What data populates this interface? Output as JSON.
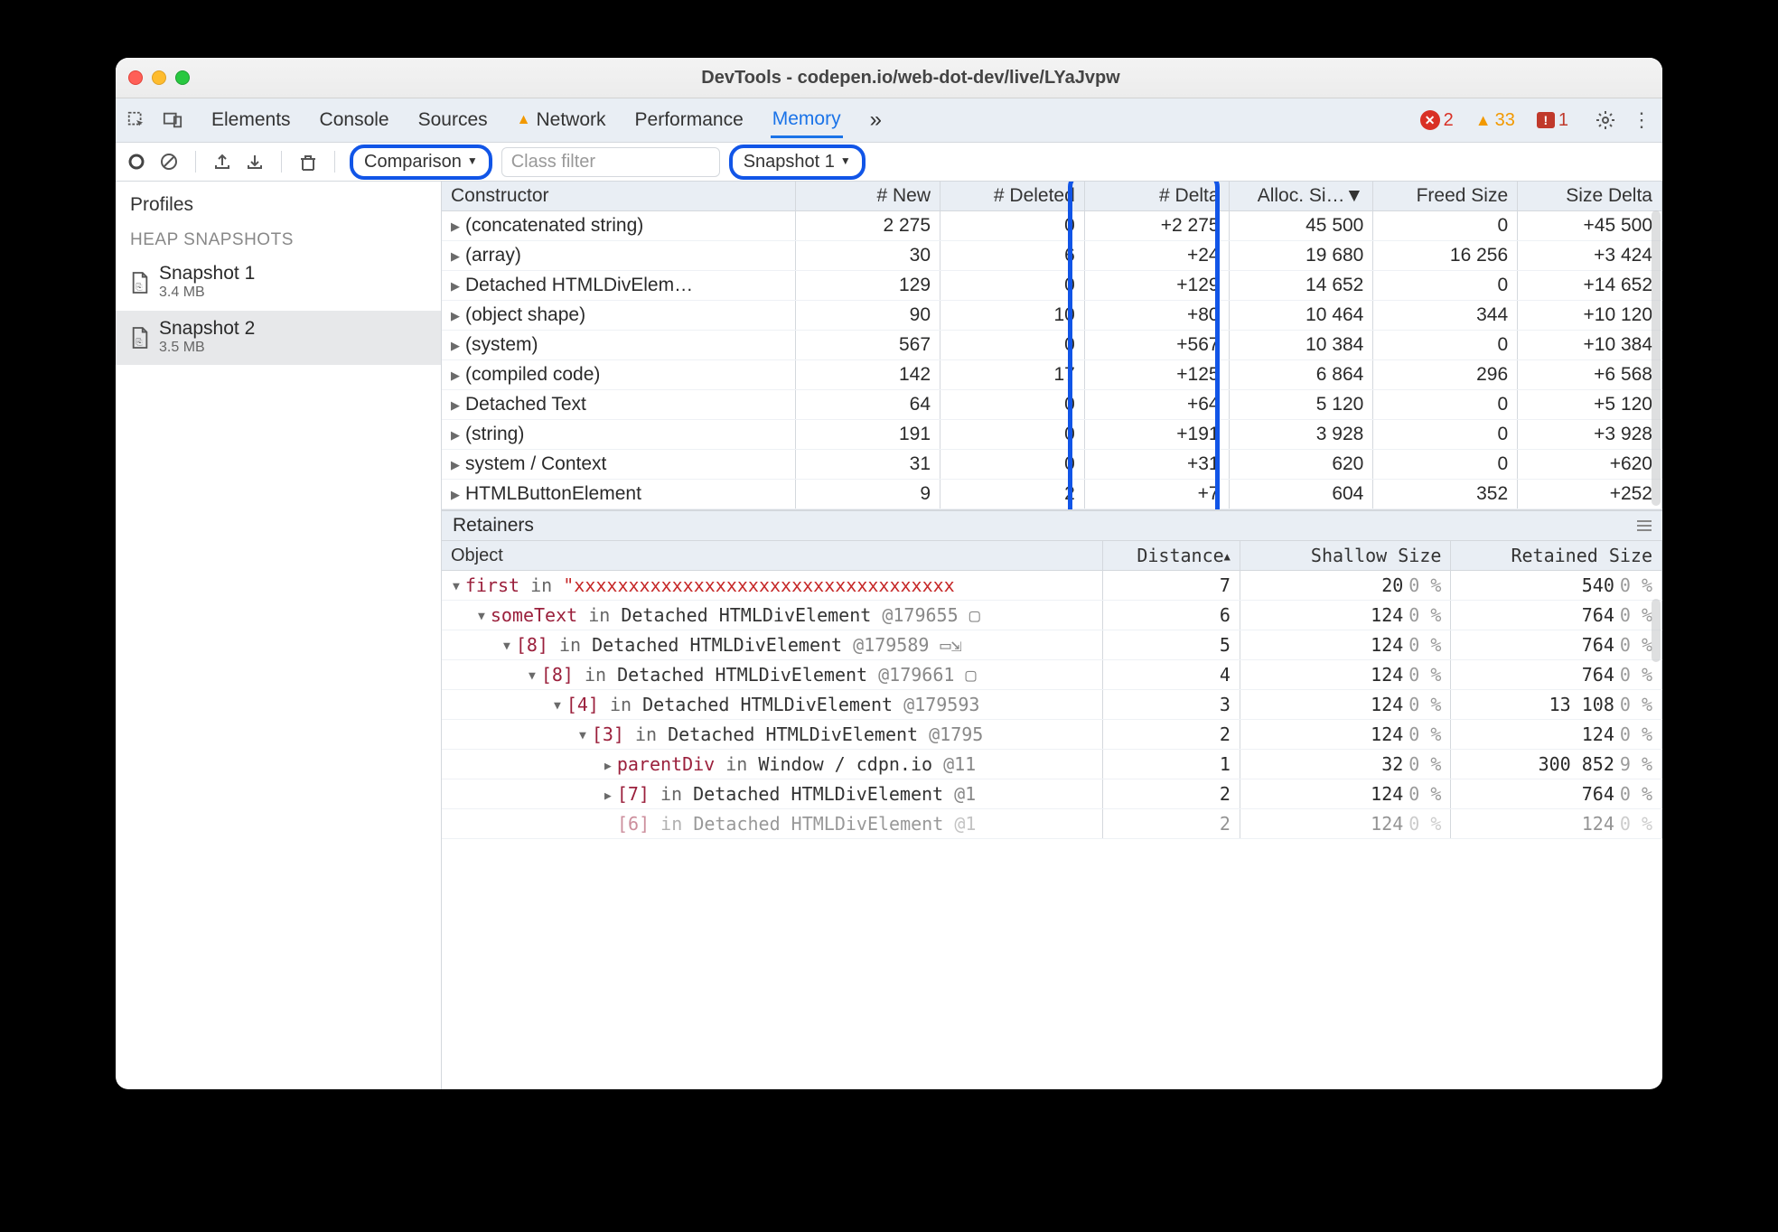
{
  "window": {
    "title": "DevTools - codepen.io/web-dot-dev/live/LYaJvpw"
  },
  "tabstrip": {
    "tabs": [
      "Elements",
      "Console",
      "Sources",
      "Network",
      "Performance",
      "Memory"
    ],
    "active": "Memory",
    "overflow": "»",
    "errors": 2,
    "warnings": 33,
    "messages": 1
  },
  "toolbar": {
    "view_label": "Comparison",
    "filter_placeholder": "Class filter",
    "baseline_label": "Snapshot 1"
  },
  "sidebar": {
    "title": "Profiles",
    "section": "HEAP SNAPSHOTS",
    "items": [
      {
        "name": "Snapshot 1",
        "size": "3.4 MB",
        "selected": false
      },
      {
        "name": "Snapshot 2",
        "size": "3.5 MB",
        "selected": true
      }
    ]
  },
  "comparison": {
    "headers": [
      "Constructor",
      "# New",
      "# Deleted",
      "# Delta",
      "Alloc. Si…",
      "Freed Size",
      "Size Delta"
    ],
    "sorted_col": 4,
    "rows": [
      {
        "name": "(concatenated string)",
        "new": "2 275",
        "del": "0",
        "delta": "+2 275",
        "alloc": "45 500",
        "freed": "0",
        "sdelta": "+45 500"
      },
      {
        "name": "(array)",
        "new": "30",
        "del": "6",
        "delta": "+24",
        "alloc": "19 680",
        "freed": "16 256",
        "sdelta": "+3 424"
      },
      {
        "name": "Detached HTMLDivElem…",
        "new": "129",
        "del": "0",
        "delta": "+129",
        "alloc": "14 652",
        "freed": "0",
        "sdelta": "+14 652"
      },
      {
        "name": "(object shape)",
        "new": "90",
        "del": "10",
        "delta": "+80",
        "alloc": "10 464",
        "freed": "344",
        "sdelta": "+10 120"
      },
      {
        "name": "(system)",
        "new": "567",
        "del": "0",
        "delta": "+567",
        "alloc": "10 384",
        "freed": "0",
        "sdelta": "+10 384"
      },
      {
        "name": "(compiled code)",
        "new": "142",
        "del": "17",
        "delta": "+125",
        "alloc": "6 864",
        "freed": "296",
        "sdelta": "+6 568"
      },
      {
        "name": "Detached Text",
        "new": "64",
        "del": "0",
        "delta": "+64",
        "alloc": "5 120",
        "freed": "0",
        "sdelta": "+5 120"
      },
      {
        "name": "(string)",
        "new": "191",
        "del": "0",
        "delta": "+191",
        "alloc": "3 928",
        "freed": "0",
        "sdelta": "+3 928"
      },
      {
        "name": "system / Context",
        "new": "31",
        "del": "0",
        "delta": "+31",
        "alloc": "620",
        "freed": "0",
        "sdelta": "+620"
      },
      {
        "name": "HTMLButtonElement",
        "new": "9",
        "del": "2",
        "delta": "+7",
        "alloc": "604",
        "freed": "352",
        "sdelta": "+252"
      }
    ]
  },
  "retainers": {
    "title": "Retainers",
    "headers": [
      "Object",
      "Distance",
      "Shallow Size",
      "Retained Size"
    ],
    "sorted_col": 1,
    "rows": [
      {
        "depth": 0,
        "open": true,
        "prop": "first",
        "in": "in",
        "rest": "\"xxxxxxxxxxxxxxxxxxxxxxxxxxxxxxxxxxx",
        "truncated": true,
        "red": true,
        "dist": "7",
        "shallow": "20",
        "spct": "0 %",
        "ret": "540",
        "rpct": "0 %"
      },
      {
        "depth": 1,
        "open": true,
        "prop": "someText",
        "in": "in",
        "cls": "Detached HTMLDivElement",
        "id": "@179655",
        "icon": "▢",
        "dist": "6",
        "shallow": "124",
        "spct": "0 %",
        "ret": "764",
        "rpct": "0 %"
      },
      {
        "depth": 2,
        "open": true,
        "prop": "[8]",
        "in": "in",
        "cls": "Detached HTMLDivElement",
        "id": "@179589",
        "icon": "▭⇲",
        "dist": "5",
        "shallow": "124",
        "spct": "0 %",
        "ret": "764",
        "rpct": "0 %"
      },
      {
        "depth": 3,
        "open": true,
        "prop": "[8]",
        "in": "in",
        "cls": "Detached HTMLDivElement",
        "id": "@179661",
        "icon": "▢",
        "dist": "4",
        "shallow": "124",
        "spct": "0 %",
        "ret": "764",
        "rpct": "0 %"
      },
      {
        "depth": 4,
        "open": true,
        "prop": "[4]",
        "in": "in",
        "cls": "Detached HTMLDivElement",
        "id": "@179593",
        "dist": "3",
        "shallow": "124",
        "spct": "0 %",
        "ret": "13 108",
        "rpct": "0 %"
      },
      {
        "depth": 5,
        "open": true,
        "prop": "[3]",
        "in": "in",
        "cls": "Detached HTMLDivElement",
        "id": "@1795",
        "dist": "2",
        "shallow": "124",
        "spct": "0 %",
        "ret": "124",
        "rpct": "0 %"
      },
      {
        "depth": 6,
        "open": false,
        "prop": "parentDiv",
        "in": "in",
        "cls": "Window / cdpn.io",
        "id": "@11",
        "dist": "1",
        "shallow": "32",
        "spct": "0 %",
        "ret": "300 852",
        "rpct": "9 %"
      },
      {
        "depth": 6,
        "open": false,
        "prop": "[7]",
        "in": "in",
        "cls": "Detached HTMLDivElement",
        "id": "@1",
        "dist": "2",
        "shallow": "124",
        "spct": "0 %",
        "ret": "764",
        "rpct": "0 %"
      },
      {
        "depth": 6,
        "open": null,
        "prop": "[6]",
        "in": "in",
        "cls": "Detached HTMLDivElement",
        "id": "@1",
        "faded": true,
        "dist": "2",
        "shallow": "124",
        "spct": "0 %",
        "ret": "124",
        "rpct": "0 %"
      }
    ]
  }
}
